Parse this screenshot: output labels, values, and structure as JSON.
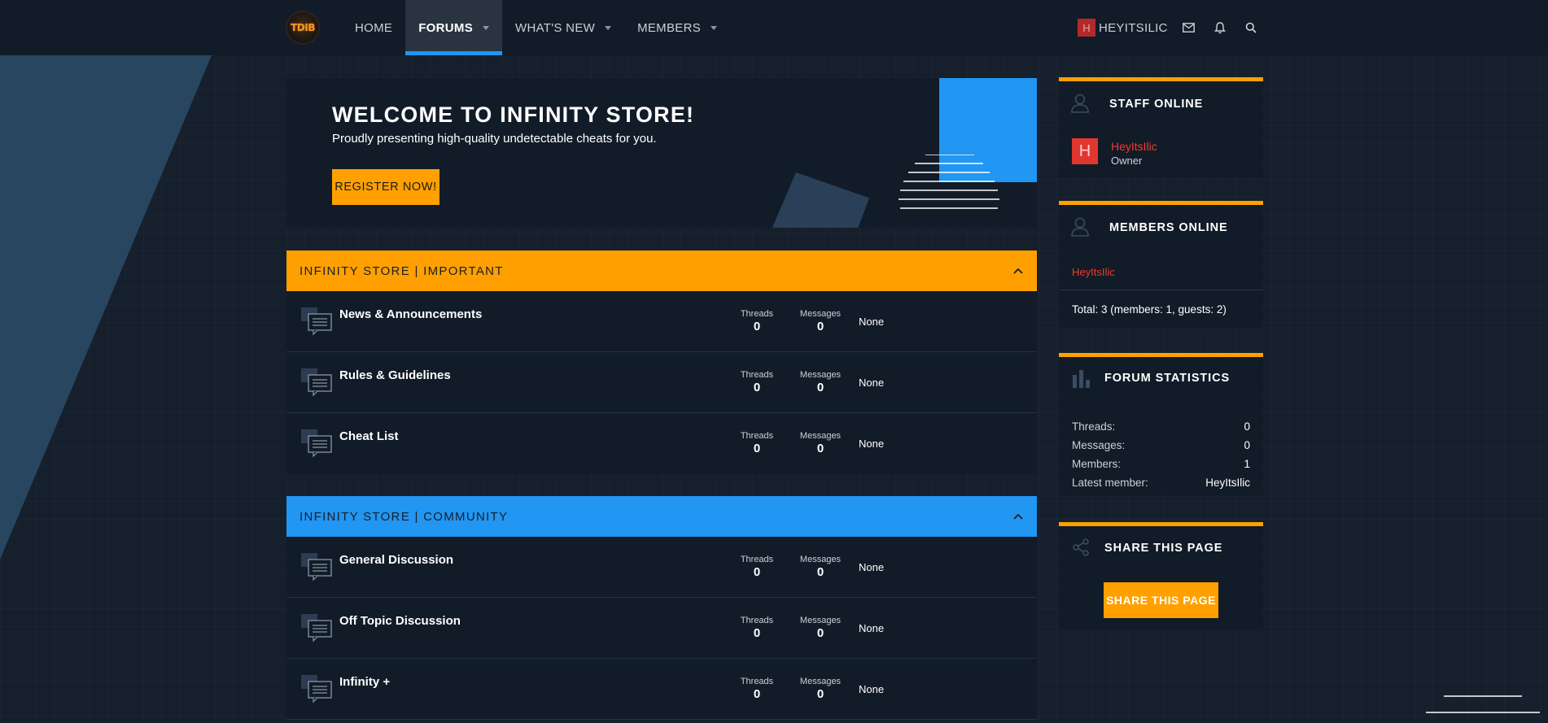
{
  "header": {
    "logo_text": "TDIB",
    "nav": [
      {
        "label": "HOME",
        "has_caret": false,
        "active": false
      },
      {
        "label": "FORUMS",
        "has_caret": true,
        "active": true
      },
      {
        "label": "WHAT'S NEW",
        "has_caret": true,
        "active": false
      },
      {
        "label": "MEMBERS",
        "has_caret": true,
        "active": false
      }
    ],
    "user": {
      "avatar_letter": "H",
      "name": "HEYITSILIC"
    },
    "icons": [
      "mail-icon",
      "bell-icon",
      "search-icon"
    ]
  },
  "welcome": {
    "title": "WELCOME TO INFINITY STORE!",
    "subtitle": "Proudly presenting high-quality undetectable cheats for you.",
    "register_label": "REGISTER NOW!"
  },
  "categories": [
    {
      "title": "INFINITY STORE | IMPORTANT",
      "color": "#ffa000",
      "forums": [
        {
          "title": "News & Announcements",
          "threads_label": "Threads",
          "threads": "0",
          "messages_label": "Messages",
          "messages": "0",
          "last": "None"
        },
        {
          "title": "Rules & Guidelines",
          "threads_label": "Threads",
          "threads": "0",
          "messages_label": "Messages",
          "messages": "0",
          "last": "None"
        },
        {
          "title": "Cheat List",
          "threads_label": "Threads",
          "threads": "0",
          "messages_label": "Messages",
          "messages": "0",
          "last": "None"
        }
      ]
    },
    {
      "title": "INFINITY STORE | COMMUNITY",
      "color": "#2196f3",
      "forums": [
        {
          "title": "General Discussion",
          "threads_label": "Threads",
          "threads": "0",
          "messages_label": "Messages",
          "messages": "0",
          "last": "None"
        },
        {
          "title": "Off Topic Discussion",
          "threads_label": "Threads",
          "threads": "0",
          "messages_label": "Messages",
          "messages": "0",
          "last": "None"
        },
        {
          "title": "Infinity +",
          "threads_label": "Threads",
          "threads": "0",
          "messages_label": "Messages",
          "messages": "0",
          "last": "None"
        }
      ]
    }
  ],
  "sidebar": {
    "staff_online": {
      "title": "STAFF ONLINE",
      "member": {
        "avatar_letter": "H",
        "name": "HeyItsIlic",
        "role": "Owner"
      }
    },
    "members_online": {
      "title": "MEMBERS ONLINE",
      "member": "HeyItsIlic",
      "total": "Total: 3 (members: 1, guests: 2)"
    },
    "forum_statistics": {
      "title": "FORUM STATISTICS",
      "rows": [
        {
          "key": "Threads:",
          "value": "0"
        },
        {
          "key": "Messages:",
          "value": "0"
        },
        {
          "key": "Members:",
          "value": "1"
        },
        {
          "key": "Latest member:",
          "value": "HeyItsIlic"
        }
      ]
    },
    "share": {
      "title": "SHARE THIS PAGE",
      "button_label": "SHARE THIS PAGE"
    }
  },
  "colors": {
    "accent_orange": "#ffa000",
    "accent_blue": "#2196f3",
    "panel_bg": "#121c28",
    "page_bg": "#16202c",
    "name_red": "#f03a2e"
  }
}
